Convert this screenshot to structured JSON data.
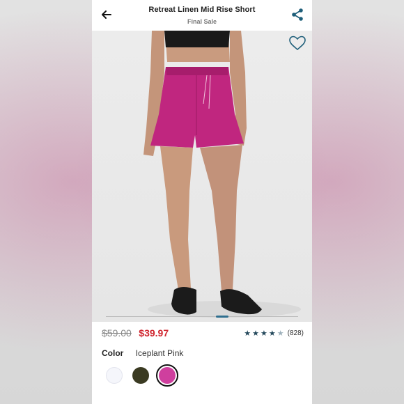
{
  "header": {
    "title": "Retreat Linen Mid Rise Short",
    "subtitle": "Final Sale",
    "back_icon": "arrow-left-icon",
    "share_icon": "share-icon"
  },
  "hero": {
    "favorite_icon": "heart-outline-icon",
    "image_description": "model-wearing-pink-linen-shorts-and-black-slides"
  },
  "pricing": {
    "original_price": "$59.00",
    "sale_price": "$39.97",
    "sale_color": "#d0262f"
  },
  "rating": {
    "stars": 4.5,
    "count": "(828)"
  },
  "color": {
    "label": "Color",
    "selected_name": "Iceplant Pink",
    "swatches": [
      {
        "name": "white",
        "hex": "#f5f6fb"
      },
      {
        "name": "olive",
        "hex": "#3a3a22"
      },
      {
        "name": "iceplant-pink",
        "hex": "#cf3f9e",
        "selected": true
      }
    ]
  },
  "theme": {
    "accent": "#2f6f8f"
  }
}
